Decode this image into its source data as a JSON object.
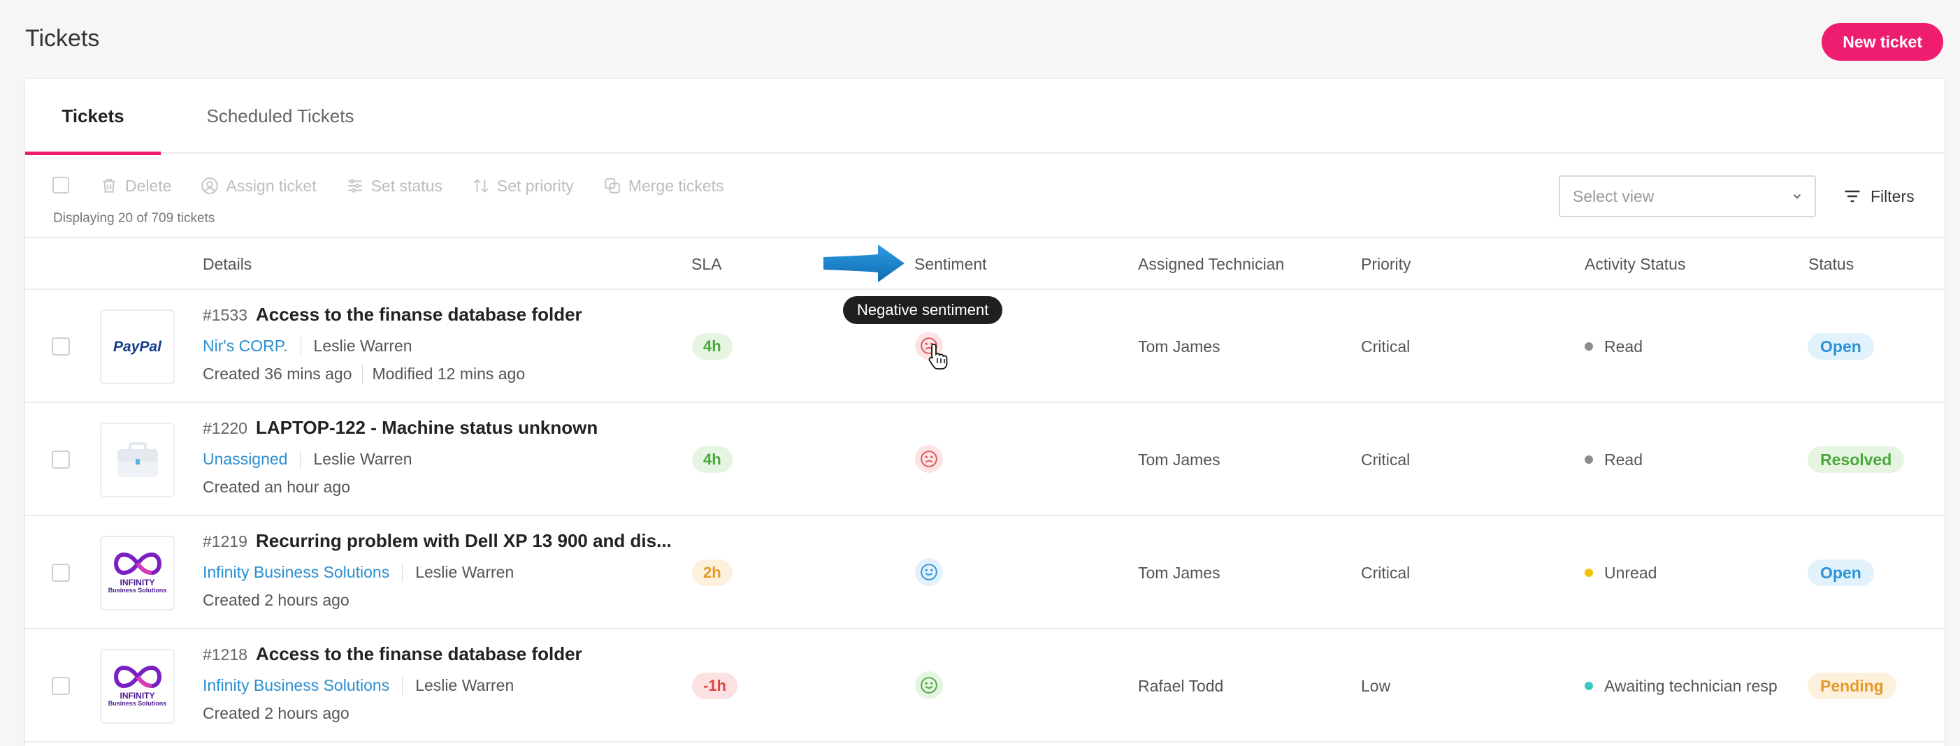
{
  "header": {
    "title": "Tickets",
    "new_ticket_label": "New ticket"
  },
  "colors": {
    "accent": "#ee1d6f",
    "link": "#2a8fd1"
  },
  "tabs": [
    {
      "label": "Tickets",
      "active": true
    },
    {
      "label": "Scheduled Tickets",
      "active": false
    }
  ],
  "toolbar": {
    "actions": [
      {
        "label": "Delete",
        "icon": "trash-icon"
      },
      {
        "label": "Assign ticket",
        "icon": "user-circle-icon"
      },
      {
        "label": "Set status",
        "icon": "sliders-icon"
      },
      {
        "label": "Set priority",
        "icon": "sort-arrows-icon"
      },
      {
        "label": "Merge tickets",
        "icon": "merge-icon"
      }
    ],
    "count_text": "Displaying 20 of 709 tickets",
    "select_view_placeholder": "Select view",
    "filters_label": "Filters"
  },
  "columns": {
    "details": "Details",
    "sla": "SLA",
    "sentiment": "Sentiment",
    "technician": "Assigned Technician",
    "priority": "Priority",
    "activity": "Activity Status",
    "status": "Status"
  },
  "tooltip": "Negative sentiment",
  "rows": [
    {
      "number": "#1533",
      "subject": "Access to the finanse database folder",
      "company": "Nir's CORP.",
      "requester": "Leslie Warren",
      "created": "Created 36 mins ago",
      "modified": "Modified 12 mins ago",
      "logo": "paypal",
      "logo_text": "PayPal",
      "sla": "4h",
      "sla_kind": "ok",
      "sentiment": "negative",
      "technician": "Tom James",
      "priority": "Critical",
      "activity": "Read",
      "activity_color": "#8c8c8c",
      "status": "Open",
      "status_kind": "open"
    },
    {
      "number": "#1220",
      "subject": "LAPTOP-122 - Machine status unknown",
      "company": "Unassigned",
      "requester": "Leslie Warren",
      "created": "Created an hour ago",
      "modified": "",
      "logo": "briefcase",
      "logo_text": "",
      "sla": "4h",
      "sla_kind": "ok",
      "sentiment": "negative",
      "technician": "Tom James",
      "priority": "Critical",
      "activity": "Read",
      "activity_color": "#8c8c8c",
      "status": "Resolved",
      "status_kind": "resolved"
    },
    {
      "number": "#1219",
      "subject": "Recurring problem with Dell XP 13 900 and dis...",
      "company": "Infinity Business Solutions",
      "requester": "Leslie Warren",
      "created": "Created 2 hours ago",
      "modified": "",
      "logo": "infinity",
      "logo_text": "INFINITY",
      "logo_subtext": "Business Solutions",
      "sla": "2h",
      "sla_kind": "warn",
      "sentiment": "neutral",
      "technician": "Tom James",
      "priority": "Critical",
      "activity": "Unread",
      "activity_color": "#f2c200",
      "status": "Open",
      "status_kind": "open"
    },
    {
      "number": "#1218",
      "subject": "Access to the finanse database folder",
      "company": "Infinity Business Solutions",
      "requester": "Leslie Warren",
      "created": "Created 2 hours ago",
      "modified": "",
      "logo": "infinity",
      "logo_text": "INFINITY",
      "logo_subtext": "Business Solutions",
      "sla": "-1h",
      "sla_kind": "breached",
      "sentiment": "positive",
      "technician": "Rafael Todd",
      "priority": "Low",
      "activity": "Awaiting technician resp",
      "activity_color": "#3cc8c0",
      "status": "Pending",
      "status_kind": "pending"
    }
  ]
}
